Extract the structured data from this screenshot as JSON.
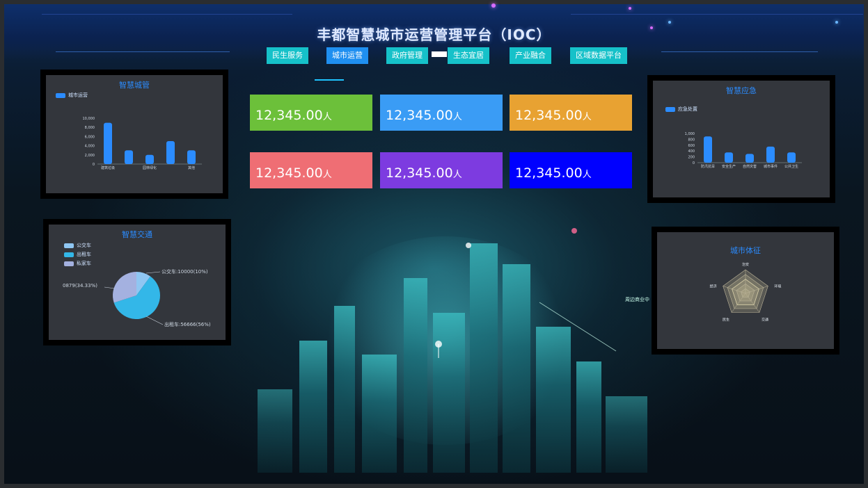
{
  "header": {
    "title": "丰都智慧城市运营管理平台（IOC）",
    "nav": [
      {
        "label": "民生服务",
        "active": false
      },
      {
        "label": "城市运营",
        "active": true
      },
      {
        "label": "政府管理",
        "active": false
      },
      {
        "label": "生态宜居",
        "active": false
      },
      {
        "label": "产业融合",
        "active": false
      },
      {
        "label": "区域数据平台",
        "active": false
      }
    ]
  },
  "stats": [
    {
      "value": "12,345.00",
      "unit": "人",
      "color": "#6cc03a"
    },
    {
      "value": "12,345.00",
      "unit": "人",
      "color": "#3a9cf5"
    },
    {
      "value": "12,345.00",
      "unit": "人",
      "color": "#e8a232"
    },
    {
      "value": "12,345.00",
      "unit": "人",
      "color": "#ef6e74"
    },
    {
      "value": "12,345.00",
      "unit": "人",
      "color": "#7d3be0"
    },
    {
      "value": "12,345.00",
      "unit": "人",
      "color": "#0000ff"
    }
  ],
  "panels": {
    "top_left": {
      "title": "智慧城管",
      "legend": "城市运营",
      "chart_data": {
        "type": "bar",
        "categories": [
          "建筑垃圾",
          "",
          "园林绿化",
          "",
          "其他"
        ],
        "values": [
          9000,
          3000,
          2000,
          5000,
          3000
        ],
        "yticks": [
          "10,000",
          "8,000",
          "6,000",
          "4,000",
          "2,000",
          "0"
        ],
        "ylim": [
          0,
          10000
        ]
      }
    },
    "bottom_left": {
      "title": "智慧交通",
      "legend": [
        "公交车",
        "出租车",
        "私家车"
      ],
      "chart_data": {
        "type": "pie",
        "slices": [
          {
            "name": "公交车",
            "value": 10000,
            "color": "#8fc6f2"
          },
          {
            "name": "出租车",
            "value": 60000,
            "color": "#33b7e8"
          },
          {
            "name": "私家车",
            "value": 30000,
            "color": "#a4b1e0"
          }
        ],
        "labels": [
          "公交车:10000(10%)",
          "0879(34.33%)",
          "出租车:56666(56%)"
        ]
      }
    },
    "top_right": {
      "title": "智慧应急",
      "legend": "应急处置",
      "chart_data": {
        "type": "bar",
        "categories": [
          "防汛抗旱",
          "安全生产",
          "自然灾害",
          "城市事件",
          "公共卫生"
        ],
        "values": [
          900,
          350,
          300,
          550,
          350
        ],
        "yticks": [
          "1,000",
          "800",
          "600",
          "400",
          "200",
          "0"
        ],
        "ylim": [
          0,
          1000
        ]
      }
    },
    "bottom_right": {
      "title": "城市体征",
      "chart_data": {
        "type": "radar",
        "axes": [
          "治安",
          "环境",
          "交通",
          "民生",
          "经济"
        ],
        "values": [
          0.6,
          0.6,
          0.6,
          0.6,
          0.6
        ]
      }
    }
  },
  "scene": {
    "callout": "周边商业中"
  },
  "colors": {
    "bar": "#2b8cff",
    "panel_title": "#2b8cff",
    "nav": "#16c1c9",
    "nav_active": "#1f8ff0"
  }
}
